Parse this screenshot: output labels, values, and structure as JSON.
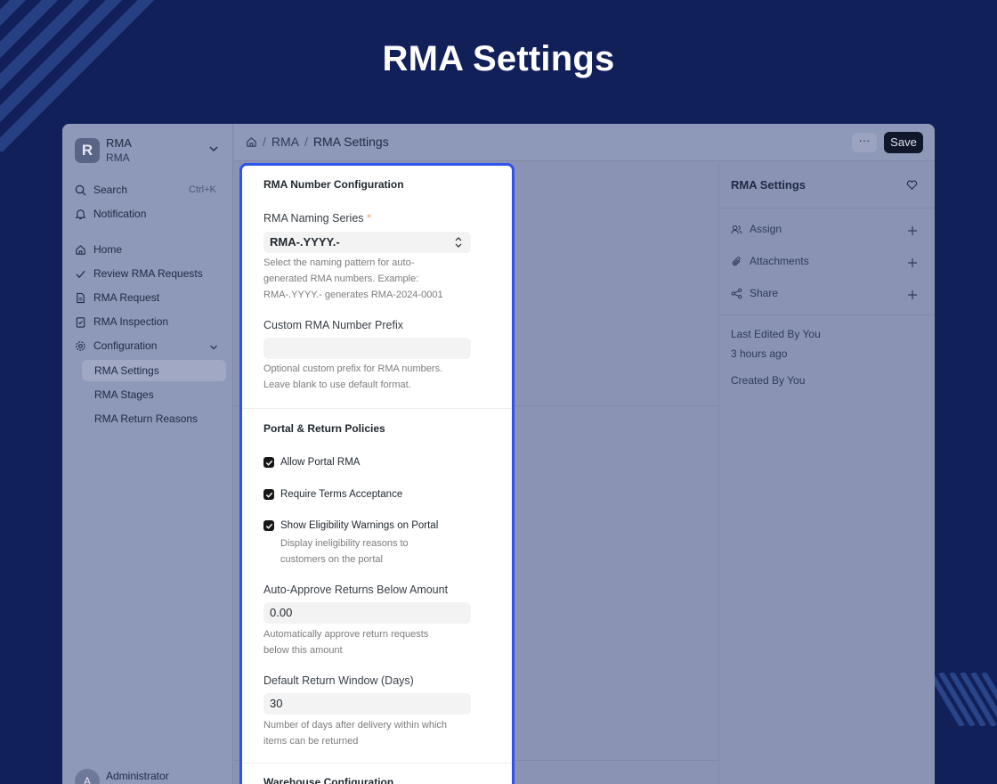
{
  "hero": {
    "title": "RMA Settings"
  },
  "sidebar": {
    "brand": {
      "logo_letter": "R",
      "name": "RMA",
      "sub": "RMA"
    },
    "search_label": "Search",
    "search_shortcut": "Ctrl+K",
    "notification_label": "Notification",
    "items": [
      {
        "label": "Home",
        "icon": "home-icon"
      },
      {
        "label": "Review RMA Requests",
        "icon": "check-icon"
      },
      {
        "label": "RMA Request",
        "icon": "document-icon"
      },
      {
        "label": "RMA Inspection",
        "icon": "clipboard-check-icon"
      },
      {
        "label": "Configuration",
        "icon": "gear-icon"
      }
    ],
    "sub_items": [
      {
        "label": "RMA Settings",
        "active": true
      },
      {
        "label": "RMA Stages",
        "active": false
      },
      {
        "label": "RMA Return Reasons",
        "active": false
      }
    ],
    "user": {
      "initial": "A",
      "name": "Administrator"
    }
  },
  "topbar": {
    "breadcrumb": [
      "RMA",
      "RMA Settings"
    ],
    "more_label": "···",
    "save_label": "Save"
  },
  "right_panel": {
    "title": "RMA Settings",
    "actions": [
      {
        "label": "Assign",
        "icon": "users-icon"
      },
      {
        "label": "Attachments",
        "icon": "paperclip-icon"
      },
      {
        "label": "Share",
        "icon": "share-icon"
      }
    ],
    "last_edited": "Last Edited By You",
    "last_edited_time": "3 hours ago",
    "created": "Created By You"
  },
  "form": {
    "section1_title": "RMA Number Configuration",
    "naming_series_label": "RMA Naming Series",
    "naming_series_required": "*",
    "naming_series_value": "RMA-.YYYY.-",
    "naming_series_desc_1": "Select the naming pattern for auto-",
    "naming_series_desc_2": "generated RMA numbers. Example:",
    "naming_series_desc_3": "RMA-.YYYY.- generates RMA-2024-0001",
    "prefix_label": "Custom RMA Number Prefix",
    "prefix_value": "",
    "prefix_desc_1": "Optional custom prefix for RMA numbers.",
    "prefix_desc_2": "Leave blank to use default format.",
    "section2_title": "Portal & Return Policies",
    "check_portal": "Allow Portal RMA",
    "check_terms": "Require Terms Acceptance",
    "check_warnings": "Show Eligibility Warnings on Portal",
    "warnings_desc_1": "Display ineligibility reasons to",
    "warnings_desc_2": "customers on the portal",
    "auto_approve_label": "Auto-Approve Returns Below Amount",
    "auto_approve_value": "0.00",
    "auto_approve_desc_1": "Automatically approve return requests",
    "auto_approve_desc_2": "below this amount",
    "return_window_label": "Default Return Window (Days)",
    "return_window_value": "30",
    "return_window_desc_1": "Number of days after delivery within which",
    "return_window_desc_2": "items can be returned",
    "section3_title": "Warehouse Configuration"
  },
  "colors": {
    "background": "#12205a",
    "highlight": "#2f54eb",
    "save_button": "#10172a"
  }
}
